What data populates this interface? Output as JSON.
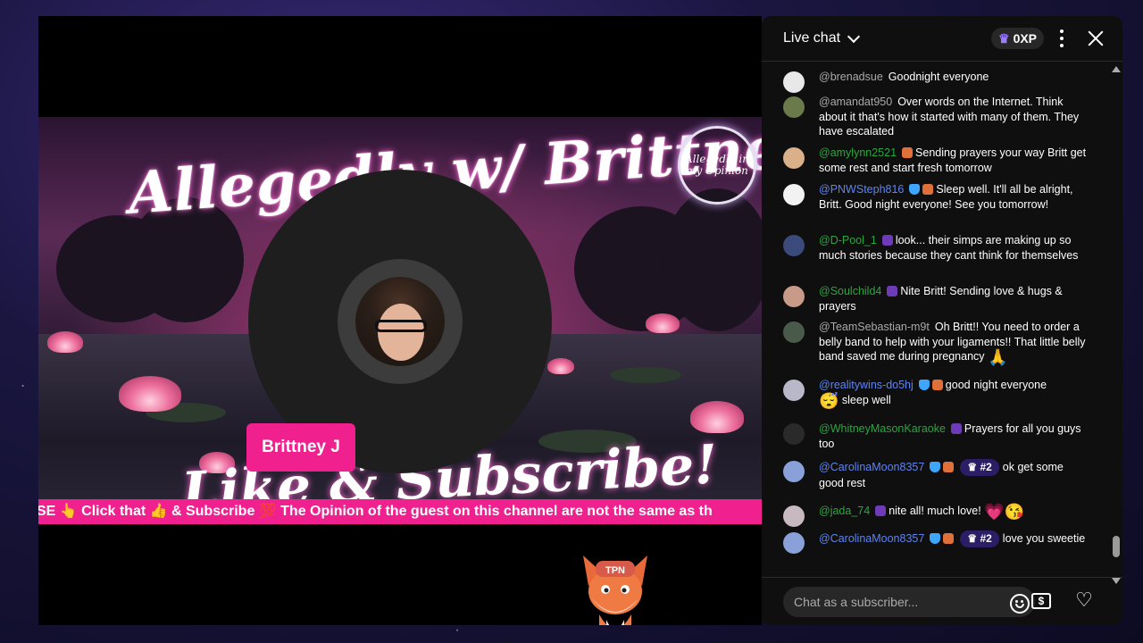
{
  "video": {
    "banner_title": "Allegedly w/ Brittney J",
    "banner_seal": "Allegedly in my Opinion",
    "banner_cta": "Like & Subscribe!",
    "ticker_text": "SE 👆 Click that 👍 & Subscribe 💯 The Opinion of the guest on this channel are not the same as th",
    "host_name": "Brittney J",
    "mascot_label": "TPN"
  },
  "chat": {
    "title": "Live chat",
    "xp_label": "0XP",
    "input_placeholder": "Chat as a subscriber...",
    "messages": [
      {
        "author": "@brenadsue",
        "text": "Goodnight everyone",
        "color": "grey"
      },
      {
        "author": "@amandat950",
        "text": "Over words on the Internet. Think about it that's how it started with many of them. They have escalated",
        "color": "grey"
      },
      {
        "author": "@amylynn2521",
        "text": "Sending prayers your way Britt get some rest and start fresh tomorrow",
        "color": "green"
      },
      {
        "author": "@PNWSteph816",
        "text": "Sleep well. It'll all be alright, Britt. Good night everyone! See you tomorrow!",
        "color": "blue"
      },
      {
        "author": "@D-Pool_1",
        "text": "look... their simps are making up so much stories because they cant think for themselves",
        "color": "green"
      },
      {
        "author": "@Soulchild4",
        "text": "Nite Britt! Sending love & hugs & prayers",
        "color": "green"
      },
      {
        "author": "@TeamSebastian-m9t",
        "text": "Oh Britt!! You need to order a belly band to help with your ligaments!! That little belly band saved me during pregnancy",
        "emoji": "🙏",
        "color": "grey"
      },
      {
        "author": "@realitywins-do5hj",
        "text": "good night everyone",
        "emoji": "😴",
        "text2": "sleep well",
        "color": "blue"
      },
      {
        "author": "@WhitneyMasonKaraoke",
        "text": "Prayers for all you guys too",
        "color": "green"
      },
      {
        "author": "@CarolinaMoon8357",
        "rank": "#2",
        "text": "ok get some good rest",
        "color": "blue"
      },
      {
        "author": "@jada_74",
        "text": "nite all! much love!",
        "emoji": "💗😘",
        "color": "green"
      },
      {
        "author": "@CarolinaMoon8357",
        "rank": "#2",
        "text": "love you sweetie",
        "color": "blue"
      }
    ]
  },
  "colors": {
    "accent_pink": "#f0208f",
    "chat_bg": "#0f0f0f",
    "author_green": "#2ba640",
    "author_blue": "#5e84f1"
  }
}
